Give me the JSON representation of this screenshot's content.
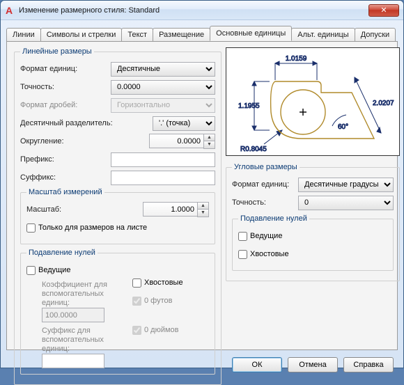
{
  "window": {
    "title": "Изменение размерного стиля: Standard",
    "close_glyph": "✕"
  },
  "tabs": {
    "t0": "Линии",
    "t1": "Символы и стрелки",
    "t2": "Текст",
    "t3": "Размещение",
    "t4": "Основные единицы",
    "t5": "Альт. единицы",
    "t6": "Допуски"
  },
  "linear": {
    "legend": "Линейные размеры",
    "format_label": "Формат единиц:",
    "format_value": "Десятичные",
    "precision_label": "Точность:",
    "precision_value": "0.0000",
    "frac_label": "Формат дробей:",
    "frac_value": "Горизонтально",
    "decsep_label": "Десятичный разделитель:",
    "decsep_value": "'.' (точка)",
    "round_label": "Округление:",
    "round_value": "0.0000",
    "prefix_label": "Префикс:",
    "prefix_value": "",
    "suffix_label": "Суффикс:",
    "suffix_value": ""
  },
  "scale": {
    "legend": "Масштаб измерений",
    "scale_label": "Масштаб:",
    "scale_value": "1.0000",
    "layout_only": "Только для размеров на листе"
  },
  "zeros": {
    "legend": "Подавление нулей",
    "leading": "Ведущие",
    "trailing": "Хвостовые",
    "factor_label": "Коэффициент для вспомогательных единиц:",
    "factor_value": "100.0000",
    "subsuffix_label": "Суффикс для вспомогательных единиц:",
    "subsuffix_value": "",
    "feet": "0 футов",
    "inches": "0 дюймов"
  },
  "angular": {
    "legend": "Угловые размеры",
    "format_label": "Формат единиц:",
    "format_value": "Десятичные градусы",
    "precision_label": "Точность:",
    "precision_value": "0",
    "zeros_legend": "Подавление нулей",
    "leading": "Ведущие",
    "trailing": "Хвостовые"
  },
  "preview": {
    "d1": "1.0159",
    "d2": "1.1955",
    "d3": "2.0207",
    "ang": "60°",
    "rad": "R0.8045"
  },
  "buttons": {
    "ok": "ОК",
    "cancel": "Отмена",
    "help": "Справка"
  },
  "spin": {
    "up": "▲",
    "down": "▼"
  }
}
